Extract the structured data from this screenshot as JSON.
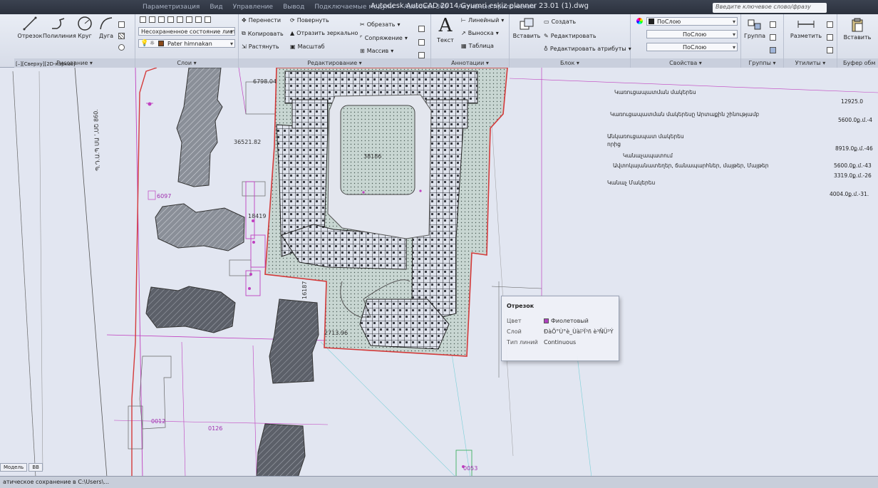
{
  "titlebar": {
    "app_title": "Autodesk AutoCAD 2014   Gyumri eskiz planner 23.01 (1).dwg",
    "menus": [
      "Параметризация",
      "Вид",
      "Управление",
      "Вывод",
      "Подключаемые модули",
      "Autodesk 360",
      "Активные приложения"
    ],
    "search_placeholder": "Введите ключевое слово/фразу"
  },
  "ribbon": {
    "draw": {
      "line": "Отрезок",
      "polyline": "Полилиния",
      "circle": "Круг",
      "arc": "Дуга",
      "title": "Рисование ▾"
    },
    "layers": {
      "layer_state": "Несохраненное состояние листа",
      "current_layer": "Pater himnakan",
      "title": "Слои ▾"
    },
    "modify": {
      "move": "Перенести",
      "rotate": "Повернуть",
      "trim": "Обрезать",
      "copy": "Копировать",
      "mirror": "Отразить зеркально",
      "fillet": "Сопряжение",
      "stretch": "Растянуть",
      "scale": "Масштаб",
      "array": "Массив",
      "title": "Редактирование ▾"
    },
    "annotation": {
      "text": "Текст",
      "linear": "Линейный",
      "leader": "Выноска",
      "table": "Таблица",
      "title": "Аннотации ▾"
    },
    "block": {
      "insert": "Вставить",
      "create": "Создать",
      "edit": "Редактировать",
      "edit_attributes": "Редактировать атрибуты",
      "title": "Блок ▾"
    },
    "properties": {
      "color": "ПоСлою",
      "linetype": "ПоСлою",
      "lineweight": "ПоСлою",
      "title": "Свойства ▾"
    },
    "groups": {
      "group": "Группа",
      "title": "Группы ▾"
    },
    "utilities": {
      "measure": "Разметить",
      "title": "Утилиты ▾"
    },
    "clipboard": {
      "paste": "Вставить",
      "title": "Буфер обм"
    }
  },
  "viewport": {
    "view_label": "[–][Сверху][2D-каркас]"
  },
  "drawing_labels": {
    "street": "Պ.Դ.Ա.Պ ՍԱ ՙ,ՍՇ 860.",
    "dim1": "6798.04",
    "dim2": "36521.82",
    "dim3": "38186",
    "dim4": "6097",
    "dim5": "18419",
    "dim6": "16187",
    "dim7": "2713.96",
    "dim8": "0012",
    "dim9": "0126",
    "dim10": "0053"
  },
  "right_table": [
    {
      "label": "Կառուցապատման մակերես",
      "value": "12925.0"
    },
    {
      "label": "Կառուցապատման մակերեսը Արտաքին շինությամբ",
      "value": "5600.0ք.մ.-4"
    },
    {
      "label": "Անկառուցապատ մակերես",
      "value": ""
    },
    {
      "label": "որից",
      "value": "8919.0ք.մ.-46"
    },
    {
      "label": "Կանաչապատում",
      "value": ""
    },
    {
      "label": "Ավտոկայանատեղեր, ճանապարհներ, մայթեր, Մայթեր",
      "value": "5600.0ք.մ.-43"
    },
    {
      "label": "",
      "value": "3319.0ք.մ.-26"
    },
    {
      "label": "Կանաչ Մակերես",
      "value": ""
    },
    {
      "label": "",
      "value": "4004.0ք.մ.-31."
    }
  ],
  "tooltip": {
    "title": "Отрезок",
    "color_key": "Цвет",
    "color_val": "Фиолетовый",
    "layer_key": "Слой",
    "layer_val": "ÐàÕ°Ù°è_Ùàï³Ï³ñ è³ÑÜ³Ý",
    "linetype_key": "Тип линий",
    "linetype_val": "Continuous"
  },
  "tabs": {
    "model": "Модель",
    "sheet": "ВВ"
  },
  "cmdline": {
    "text": "атическое сохранение в C:\\Users\\..."
  }
}
